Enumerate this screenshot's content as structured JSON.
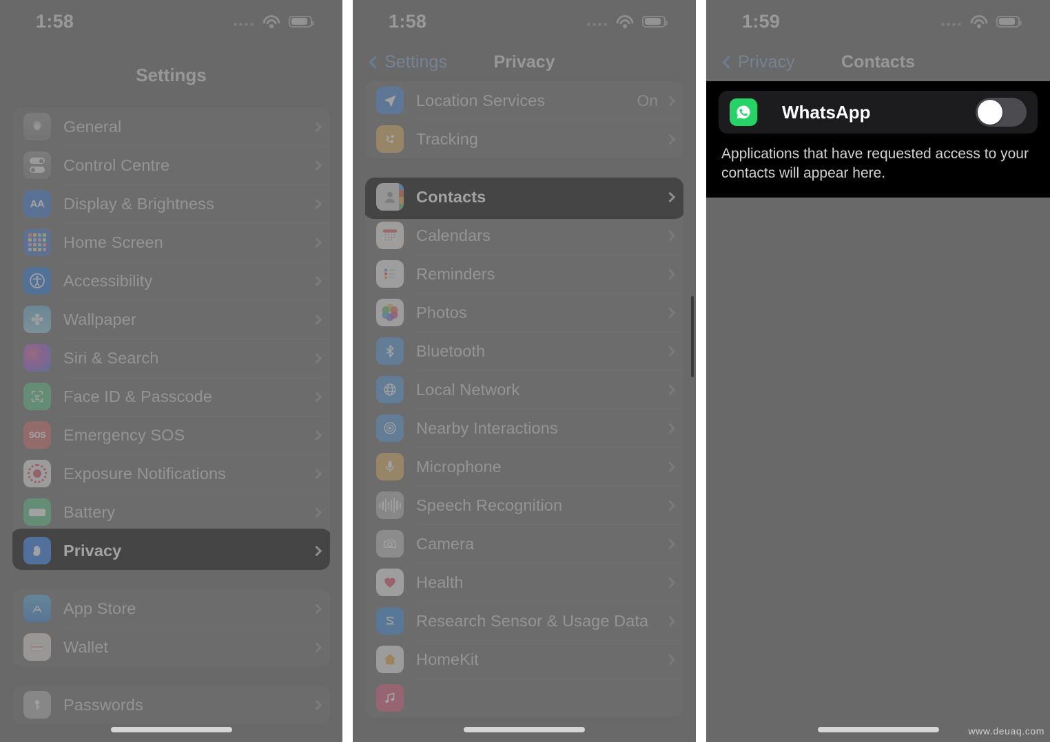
{
  "colors": {
    "dimmed_background": "#6a6a6a",
    "spotlight_background": "#0b0b0b",
    "accent_blue": "#2b7ff0",
    "back_link_blue": "#8badd0",
    "whatsapp_green": "#25d366",
    "toggle_off_track": "#4c4c50"
  },
  "watermark": "www.deuaq.com",
  "panels": [
    {
      "id": "settings",
      "status_bar": {
        "time": "1:58",
        "wifi_icon": "wifi-icon",
        "battery_icon": "battery-icon",
        "signal_icon": "signal-dots-icon"
      },
      "nav": {
        "title": "Settings",
        "back_label": null
      },
      "groups": [
        {
          "rows": [
            {
              "label": "General",
              "icon": "gear-icon",
              "chevron": true,
              "spotlight": false
            },
            {
              "label": "Control Centre",
              "icon": "toggles-icon",
              "chevron": true,
              "spotlight": false
            },
            {
              "label": "Display & Brightness",
              "icon": "aa-text-icon",
              "chevron": true,
              "spotlight": false
            },
            {
              "label": "Home Screen",
              "icon": "app-grid-icon",
              "chevron": true,
              "spotlight": false
            },
            {
              "label": "Accessibility",
              "icon": "accessibility-icon",
              "chevron": true,
              "spotlight": false
            },
            {
              "label": "Wallpaper",
              "icon": "flower-icon",
              "chevron": true,
              "spotlight": false
            },
            {
              "label": "Siri & Search",
              "icon": "siri-orb-icon",
              "chevron": true,
              "spotlight": false
            },
            {
              "label": "Face ID & Passcode",
              "icon": "face-id-icon",
              "chevron": true,
              "spotlight": false
            },
            {
              "label": "Emergency SOS",
              "icon": "sos-icon",
              "chevron": true,
              "spotlight": false
            },
            {
              "label": "Exposure Notifications",
              "icon": "exposure-ring-icon",
              "chevron": true,
              "spotlight": false
            },
            {
              "label": "Battery",
              "icon": "battery-block-icon",
              "chevron": true,
              "spotlight": false
            },
            {
              "label": "Privacy",
              "icon": "hand-icon",
              "chevron": true,
              "spotlight": true
            }
          ]
        },
        {
          "rows": [
            {
              "label": "App Store",
              "icon": "app-store-icon",
              "chevron": true,
              "spotlight": false
            },
            {
              "label": "Wallet",
              "icon": "wallet-icon",
              "chevron": true,
              "spotlight": false
            }
          ]
        },
        {
          "rows": [
            {
              "label": "Passwords",
              "icon": "key-icon",
              "chevron": true,
              "spotlight": false
            }
          ]
        }
      ]
    },
    {
      "id": "privacy",
      "status_bar": {
        "time": "1:58",
        "wifi_icon": "wifi-icon",
        "battery_icon": "battery-icon",
        "signal_icon": "signal-dots-icon"
      },
      "nav": {
        "title": "Privacy",
        "back_label": "Settings"
      },
      "groups": [
        {
          "rows": [
            {
              "label": "Location Services",
              "icon": "location-arrow-icon",
              "value": "On",
              "chevron": true,
              "spotlight": false
            },
            {
              "label": "Tracking",
              "icon": "tracking-icon",
              "value": null,
              "chevron": true,
              "spotlight": false
            }
          ]
        },
        {
          "rows": [
            {
              "label": "Contacts",
              "icon": "contacts-icon",
              "chevron": true,
              "spotlight": true
            },
            {
              "label": "Calendars",
              "icon": "calendar-icon",
              "chevron": true,
              "spotlight": false
            },
            {
              "label": "Reminders",
              "icon": "reminders-icon",
              "chevron": true,
              "spotlight": false
            },
            {
              "label": "Photos",
              "icon": "photos-icon",
              "chevron": true,
              "spotlight": false
            },
            {
              "label": "Bluetooth",
              "icon": "bluetooth-icon",
              "chevron": true,
              "spotlight": false
            },
            {
              "label": "Local Network",
              "icon": "globe-icon",
              "chevron": true,
              "spotlight": false
            },
            {
              "label": "Nearby Interactions",
              "icon": "nearby-icon",
              "chevron": true,
              "spotlight": false
            },
            {
              "label": "Microphone",
              "icon": "microphone-icon",
              "chevron": true,
              "spotlight": false
            },
            {
              "label": "Speech Recognition",
              "icon": "waveform-icon",
              "chevron": true,
              "spotlight": false
            },
            {
              "label": "Camera",
              "icon": "camera-icon",
              "chevron": true,
              "spotlight": false
            },
            {
              "label": "Health",
              "icon": "heart-icon",
              "chevron": true,
              "spotlight": false
            },
            {
              "label": "Research Sensor & Usage Data",
              "icon": "research-icon",
              "chevron": true,
              "spotlight": false
            },
            {
              "label": "HomeKit",
              "icon": "house-icon",
              "chevron": true,
              "spotlight": false
            }
          ]
        }
      ]
    },
    {
      "id": "contacts",
      "status_bar": {
        "time": "1:59",
        "wifi_icon": "wifi-icon",
        "battery_icon": "battery-icon",
        "signal_icon": "signal-dots-icon"
      },
      "nav": {
        "title": "Contacts",
        "back_label": "Privacy"
      },
      "app_row": {
        "label": "WhatsApp",
        "icon": "whatsapp-icon",
        "toggle_state": "off"
      },
      "footnote": "Applications that have requested access to your contacts will appear here."
    }
  ]
}
